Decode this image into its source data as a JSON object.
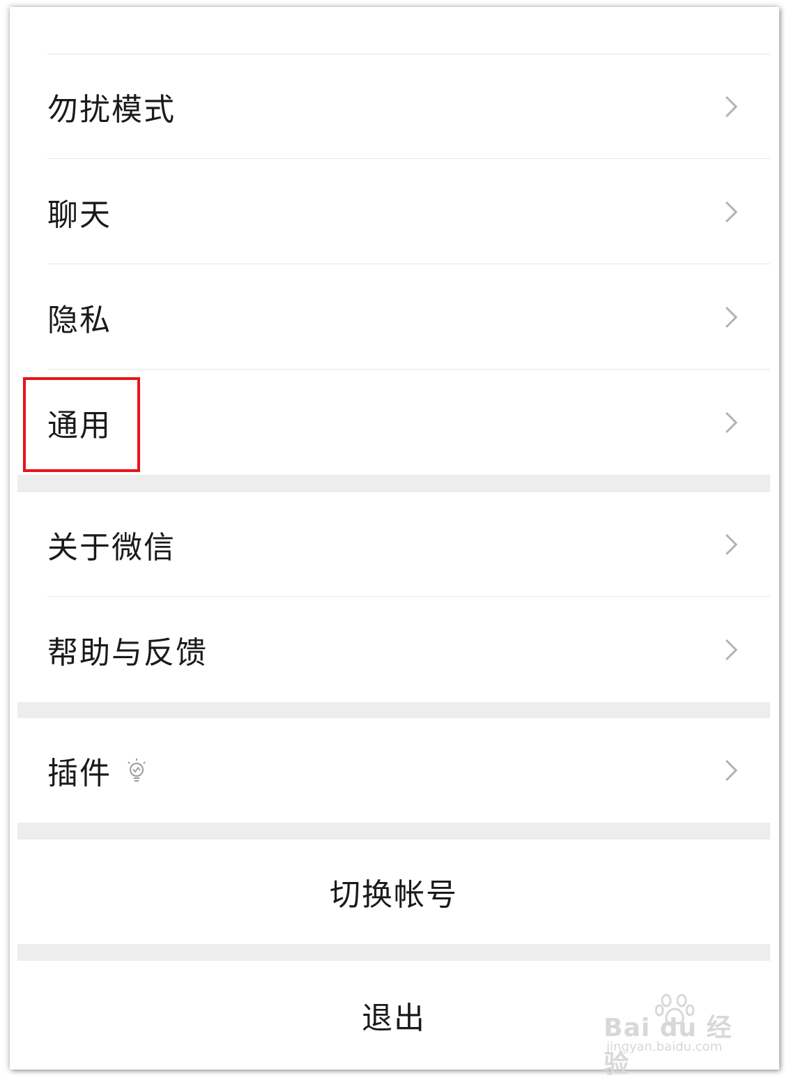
{
  "settings": {
    "items": [
      {
        "label": "勿扰模式"
      },
      {
        "label": "聊天"
      },
      {
        "label": "隐私"
      },
      {
        "label": "通用"
      }
    ],
    "about_items": [
      {
        "label": "关于微信"
      },
      {
        "label": "帮助与反馈"
      }
    ],
    "plugins": {
      "label": "插件",
      "badge_icon": "bulb-icon"
    },
    "switch_account": {
      "label": "切换帐号"
    },
    "logout": {
      "label": "退出"
    }
  },
  "annotation": {
    "highlight_color": "#e8141b",
    "highlighted_item": "通用"
  },
  "watermark": {
    "logo": "Bai du 经验",
    "url": "jingyan.baidu.com"
  },
  "colors": {
    "background": "#ffffff",
    "section_gap": "#ededed",
    "divider": "#e6e6e6",
    "text": "#1a1a1a",
    "chevron": "#b2b2b2"
  }
}
